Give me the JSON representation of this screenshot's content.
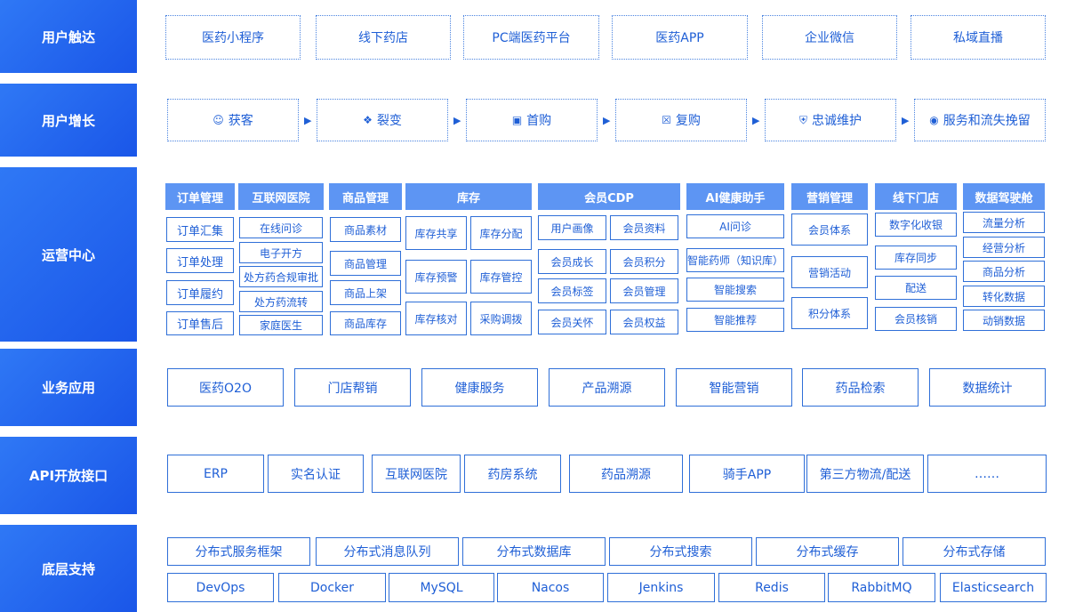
{
  "layers": {
    "touch": {
      "label": "用户触达",
      "items": [
        "医药小程序",
        "线下药店",
        "PC端医药平台",
        "医药APP",
        "企业微信",
        "私域直播"
      ]
    },
    "growth": {
      "label": "用户增长",
      "items": [
        {
          "label": "获客",
          "icon": "user-icon"
        },
        {
          "label": "裂变",
          "icon": "network-icon"
        },
        {
          "label": "首购",
          "icon": "bag-icon"
        },
        {
          "label": "复购",
          "icon": "cart-icon"
        },
        {
          "label": "忠诚维护",
          "icon": "shield-icon"
        },
        {
          "label": "服务和流失挽留",
          "icon": "location-icon"
        }
      ]
    },
    "ops": {
      "label": "运营中心",
      "groups": [
        {
          "title": "订单管理",
          "items": [
            "订单汇集",
            "订单处理",
            "订单履约",
            "订单售后"
          ]
        },
        {
          "title": "互联网医院",
          "items": [
            "在线问诊",
            "电子开方",
            "处方药合规审批",
            "处方药流转",
            "家庭医生"
          ]
        },
        {
          "title": "商品管理",
          "items": [
            "商品素材",
            "商品管理",
            "商品上架",
            "商品库存"
          ]
        },
        {
          "title": "库存",
          "items": [
            "库存共享",
            "库存分配",
            "库存预警",
            "库存管控",
            "库存核对",
            "采购调拨"
          ]
        },
        {
          "title": "会员CDP",
          "items": [
            "用户画像",
            "会员资料",
            "会员成长",
            "会员积分",
            "会员标签",
            "会员管理",
            "会员关怀",
            "会员权益"
          ]
        },
        {
          "title": "AI健康助手",
          "items": [
            "AI问诊",
            "智能药师（知识库）",
            "智能搜索",
            "智能推荐"
          ]
        },
        {
          "title": "营销管理",
          "items": [
            "会员体系",
            "营销活动",
            "积分体系"
          ]
        },
        {
          "title": "线下门店",
          "items": [
            "数字化收银",
            "库存同步",
            "配送",
            "会员核销"
          ]
        },
        {
          "title": "数据驾驶舱",
          "items": [
            "流量分析",
            "经营分析",
            "商品分析",
            "转化数据",
            "动销数据"
          ]
        }
      ]
    },
    "biz": {
      "label": "业务应用",
      "items": [
        "医药O2O",
        "门店帮销",
        "健康服务",
        "产品溯源",
        "智能营销",
        "药品检索",
        "数据统计"
      ]
    },
    "api": {
      "label": "API开放接口",
      "items": [
        "ERP",
        "实名认证",
        "互联网医院",
        "药房系统",
        "药品溯源",
        "骑手APP",
        "第三方物流/配送",
        "……"
      ]
    },
    "base": {
      "label": "底层支持",
      "row1": [
        "分布式服务框架",
        "分布式消息队列",
        "分布式数据库",
        "分布式搜索",
        "分布式缓存",
        "分布式存储"
      ],
      "row2": [
        "DevOps",
        "Docker",
        "MySQL",
        "Nacos",
        "Jenkins",
        "Redis",
        "RabbitMQ",
        "Elasticsearch"
      ]
    }
  },
  "colors": {
    "primary": "#1a56e8",
    "header": "#5d95f3",
    "text": "#1f5fd6",
    "border": "#2f6fd8"
  }
}
